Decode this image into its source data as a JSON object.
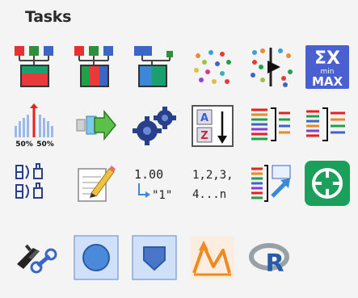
{
  "panel": {
    "title": "Tasks"
  },
  "rows": [
    {
      "tools": [
        "hierarchy-red-icon",
        "hierarchy-green-icon",
        "hierarchy-blue-icon",
        "scatter-dots-icon",
        "dots-arrow-icon",
        "sum-min-max-icon"
      ]
    },
    {
      "tools": [
        "split-50-50-icon",
        "green-arrow-icon",
        "gears-icon",
        "sort-az-icon",
        "color-lines-icon",
        "color-lines-right-icon"
      ]
    },
    {
      "tools": [
        "bracket-pairs-icon",
        "edit-pencil-icon",
        "number-to-text-icon",
        "number-sequence-icon",
        "lines-export-icon",
        "green-circle-icon"
      ]
    },
    {
      "tools": [
        "submarine-wrench-icon",
        "circle-shape-icon",
        "pentagon-shape-icon",
        "peak-curve-icon",
        "r-language-icon"
      ]
    }
  ],
  "labels": {
    "split_left": "50%",
    "split_right": "50%",
    "num_top": "1.00",
    "num_bottom": "\"1\"",
    "seq_top": "1,2,3,",
    "seq_bottom": "4...n",
    "sort_a": "A",
    "sort_z": "Z",
    "sum_sigma": "ΣX",
    "sum_min": "min",
    "sum_max": "MAX",
    "r_letter": "R"
  },
  "colors": {
    "background": "#f4f4f4",
    "green": "#1aa05a",
    "blue": "#4a76c9",
    "red": "#e03030"
  }
}
